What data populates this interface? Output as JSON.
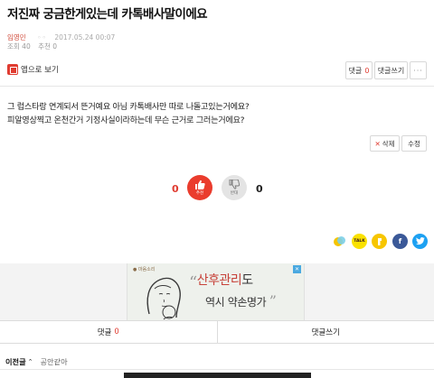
{
  "post": {
    "title": "저진짜 궁금한게있는데 카톡배사말이에요",
    "author": "임영민",
    "author_dots": "◦◦",
    "date": "2017.05.24 00:07",
    "views": "조회 40",
    "recommend": "추천 0",
    "body_line1": "그 럽스타랑 연계되서 뜬거예요 아님 카톡배사만 따로 나돌고있는거에요?",
    "body_line2": "피알영상찍고 온천간거 기정사실이라하는데 무슨 근거로 그러는거에요?"
  },
  "toolbar": {
    "app_view_label": "앱으로 보기",
    "comment_label": "댓글",
    "comment_count": "0",
    "write_comment_label": "댓글쓰기",
    "more_label": "···"
  },
  "edit": {
    "delete_label": "삭제",
    "delete_mark": "✕",
    "modify_label": "수정"
  },
  "vote": {
    "up_count": "0",
    "up_label": "추천",
    "down_count": "0",
    "down_label": "반대"
  },
  "share": {
    "talk_label": "TALK",
    "facebook_glyph": "f",
    "twitter_glyph": "t"
  },
  "ad": {
    "brand": "● 마음소리",
    "close": "✕",
    "open_quote": "“",
    "headline_highlight": "산후관리",
    "headline_rest": "도",
    "sub": "역시 약손명가",
    "close_quote": "”"
  },
  "tabs": {
    "comment_label": "댓글",
    "comment_count": "0",
    "write_label": "댓글쓰기"
  },
  "prev_post": {
    "label": "이전글",
    "arrow": "⌃",
    "title": "공안같아"
  },
  "colors": {
    "accent": "#e03c31",
    "vote_up": "#ea3c2d",
    "facebook": "#3b5998",
    "twitter": "#1da1f2",
    "kakao": "#fae100"
  }
}
